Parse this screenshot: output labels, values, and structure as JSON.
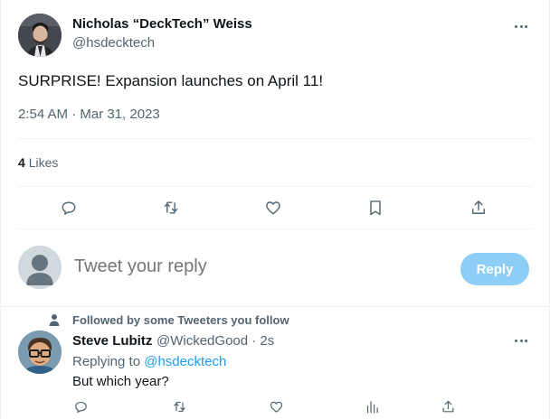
{
  "tweet": {
    "author": {
      "name": "Nicholas “DeckTech” Weiss",
      "handle": "@hsdecktech"
    },
    "text": "SURPRISE! Expansion launches on April 11!",
    "meta": "2:54 AM · Mar 31, 2023",
    "stats": {
      "likes_count": "4",
      "likes_label": "Likes"
    },
    "actions": [
      "reply-icon",
      "retweet-icon",
      "like-icon",
      "bookmark-icon",
      "share-icon"
    ]
  },
  "composer": {
    "placeholder": "Tweet your reply",
    "button_label": "Reply",
    "button_color": "#8ecdf7"
  },
  "reply": {
    "context": "Followed by some Tweeters you follow",
    "name": "Steve Lubitz",
    "handle_time": "@WickedGood · 2s",
    "replying_prefix": "Replying to ",
    "replying_to": "@hsdecktech",
    "text": "But which year?",
    "actions": [
      "reply-icon",
      "retweet-icon",
      "like-icon",
      "views-icon",
      "share-icon"
    ]
  },
  "colors": {
    "text_primary": "#0f1419",
    "text_secondary": "#536471",
    "link": "#1d9bf0",
    "divider": "#eff3f4"
  }
}
